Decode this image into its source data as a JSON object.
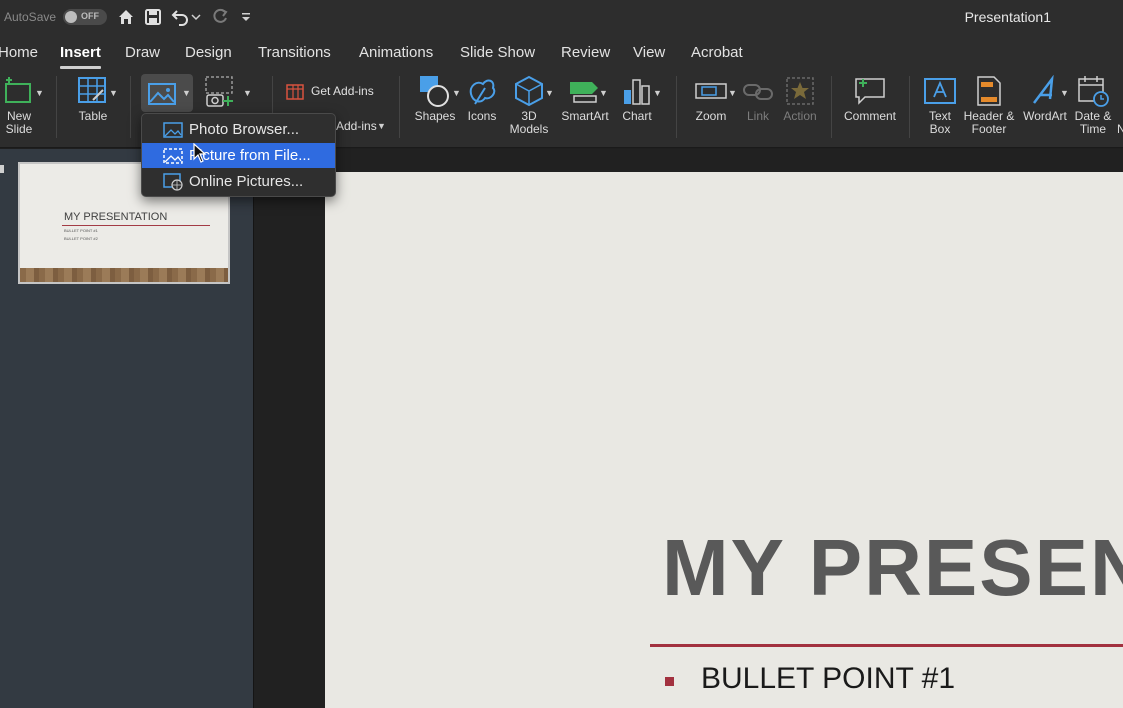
{
  "titlebar": {
    "autosave_label": "AutoSave",
    "autosave_state": "OFF",
    "document_title": "Presentation1"
  },
  "tabs": [
    {
      "label": "Home",
      "active": false
    },
    {
      "label": "Insert",
      "active": true
    },
    {
      "label": "Draw",
      "active": false
    },
    {
      "label": "Design",
      "active": false
    },
    {
      "label": "Transitions",
      "active": false
    },
    {
      "label": "Animations",
      "active": false
    },
    {
      "label": "Slide Show",
      "active": false
    },
    {
      "label": "Review",
      "active": false
    },
    {
      "label": "View",
      "active": false
    },
    {
      "label": "Acrobat",
      "active": false
    }
  ],
  "ribbon": {
    "new_slide": "New\nSlide",
    "table": "Table",
    "get_addins": "Get Add-ins",
    "my_addins": "Add-ins",
    "shapes": "Shapes",
    "icons": "Icons",
    "models_3d": "3D\nModels",
    "smartart": "SmartArt",
    "chart": "Chart",
    "zoom": "Zoom",
    "link": "Link",
    "action": "Action",
    "comment": "Comment",
    "text_box": "Text\nBox",
    "header_footer": "Header &\nFooter",
    "wordart": "WordArt",
    "date_time": "Date &\nTime",
    "partial_next": "N"
  },
  "picture_menu": {
    "items": [
      {
        "label": "Photo Browser...",
        "icon": "photo-browser-icon",
        "highlighted": false
      },
      {
        "label": "Picture from File...",
        "icon": "picture-file-icon",
        "highlighted": true
      },
      {
        "label": "Online Pictures...",
        "icon": "online-pictures-icon",
        "highlighted": false
      }
    ]
  },
  "thumbnail": {
    "title": "MY PRESENTATION",
    "bullets": [
      "BULLET POINT #1",
      "BULLET POINT #2"
    ]
  },
  "slide": {
    "title": "MY PRESENTATION",
    "bullet": "BULLET POINT #1"
  },
  "colors": {
    "accent_red": "#a2313f",
    "menu_highlight": "#2f6be0",
    "icon_blue": "#4a9fe8",
    "icon_green": "#3fb15a",
    "icon_orange": "#e58a2b"
  }
}
